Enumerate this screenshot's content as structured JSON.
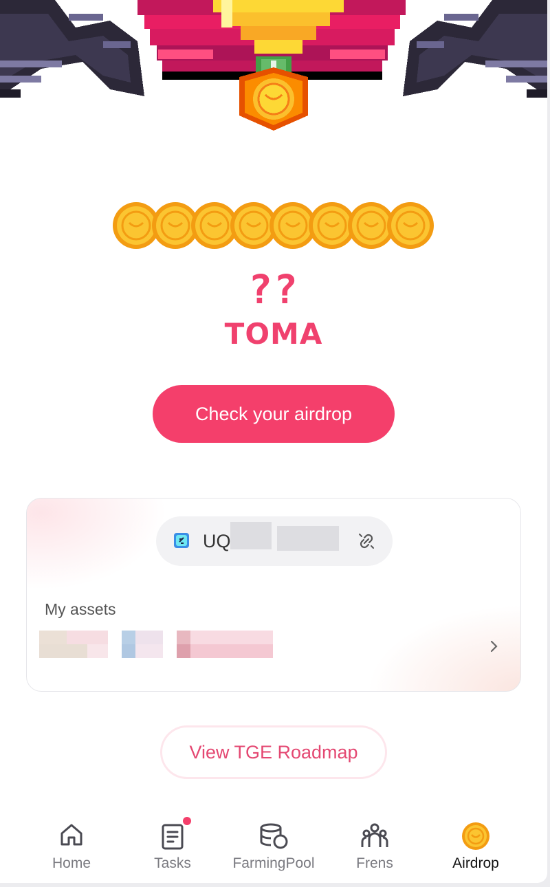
{
  "reward": {
    "amount": "??",
    "token": "TOMA"
  },
  "actions": {
    "check_airdrop": "Check your airdrop",
    "view_roadmap": "View TGE Roadmap"
  },
  "wallet": {
    "address_prefix": "UQ"
  },
  "assets": {
    "label": "My assets"
  },
  "nav": {
    "items": [
      {
        "label": "Home",
        "icon": "home-icon",
        "active": false
      },
      {
        "label": "Tasks",
        "icon": "tasks-icon",
        "active": false,
        "notification": true
      },
      {
        "label": "FarmingPool",
        "icon": "farming-pool-icon",
        "active": false
      },
      {
        "label": "Frens",
        "icon": "frens-icon",
        "active": false
      },
      {
        "label": "Airdrop",
        "icon": "airdrop-coin-icon",
        "active": true
      }
    ]
  },
  "colors": {
    "accent": "#f43f6b",
    "accent_text": "#f0416e",
    "coin_gold": "#fbc531",
    "coin_orange": "#f39c12"
  }
}
